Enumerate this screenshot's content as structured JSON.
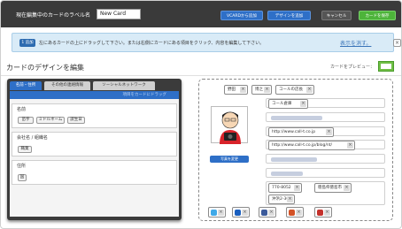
{
  "topbar": {
    "label": "現在編集中のカードのラベル名",
    "card_name": "New Card",
    "vcard_button": "VCARDから追加",
    "design_button": "デザインを追加",
    "cancel_button": "キャンセル",
    "save_button": "カードを保存"
  },
  "info": {
    "tag": "1 追加",
    "message": "左にあるカードの上にドラッグして下さい。または右側にカードにある項目をクリック、内容を編集して下さい。",
    "link": "表示を消す。",
    "close": "×"
  },
  "section_title": "カードのデザインを編集",
  "preview_label": "カードをプレビュー：",
  "tabs": [
    "名前・住所",
    "その他の連絡情報",
    "ソーシャルネットワーク"
  ],
  "hint": "項目をカードにドラッグ",
  "fields": [
    {
      "label": "名前",
      "chips": [
        "苗字",
        "ミドルネーム",
        "誕生日"
      ]
    },
    {
      "label": "会社名 / 組織名",
      "chips": [
        "職業"
      ]
    },
    {
      "label": "住所",
      "chips": [
        "国"
      ]
    }
  ],
  "card": {
    "name_tags": [
      "野田",
      "博之",
      "コールの店長"
    ],
    "company": "コール倉庫",
    "urls": [
      "http://www.call-t.co.jp",
      "http://www.call-t.co.jp/blog/nt/"
    ],
    "postal": "770-8052",
    "pref": "徳島県徳島市",
    "address": "沖浜2-30",
    "photo_button": "写真を変更"
  },
  "social_icons": [
    "twitter-icon",
    "ustream-icon",
    "facebook-icon",
    "tumblr-icon",
    "youtube-icon"
  ],
  "colors": {
    "topbar": "#3a3a3a",
    "accent_blue": "#2e6fc7",
    "save_green": "#4db43a",
    "info_bg": "#d9ebf7"
  }
}
